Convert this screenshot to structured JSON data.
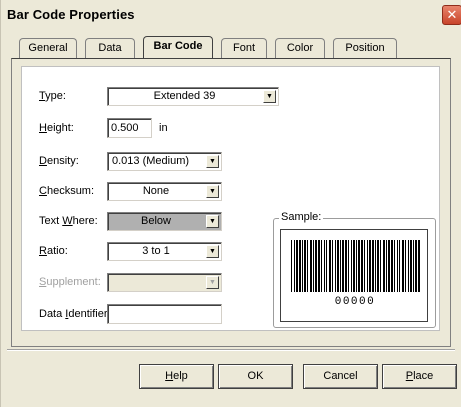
{
  "window": {
    "title": "Bar Code Properties",
    "close_glyph": "✕"
  },
  "tabs": [
    {
      "label": "General"
    },
    {
      "label": "Data"
    },
    {
      "label": "Bar Code"
    },
    {
      "label": "Font"
    },
    {
      "label": "Color"
    },
    {
      "label": "Position"
    }
  ],
  "form": {
    "type": {
      "label_key": "T",
      "label_rest": "ype:",
      "value": "Extended 39"
    },
    "height": {
      "label_key": "H",
      "label_rest": "eight:",
      "value": "0.500",
      "unit": "in"
    },
    "density": {
      "label_key": "D",
      "label_rest": "ensity:",
      "value": "0.013 (Medium)"
    },
    "checksum": {
      "label_key": "C",
      "label_rest": "hecksum:",
      "value": "None"
    },
    "text_where": {
      "label_pre": "Text ",
      "label_key": "W",
      "label_rest": "here:",
      "value": "Below"
    },
    "ratio": {
      "label_key": "R",
      "label_rest": "atio:",
      "value": "3 to 1"
    },
    "supplement": {
      "label_key": "S",
      "label_rest": "upplement:",
      "value": ""
    },
    "data_identifier": {
      "label_pre": "Data ",
      "label_key": "I",
      "label_rest": "dentifier:",
      "value": ""
    }
  },
  "sample": {
    "label": "Sample:",
    "human_readable": "00000"
  },
  "buttons": {
    "help": {
      "key": "H",
      "rest": "elp"
    },
    "ok": "OK",
    "cancel": "Cancel",
    "place": {
      "key": "P",
      "rest": "lace"
    }
  },
  "icons": {
    "dropdown": "▼"
  }
}
